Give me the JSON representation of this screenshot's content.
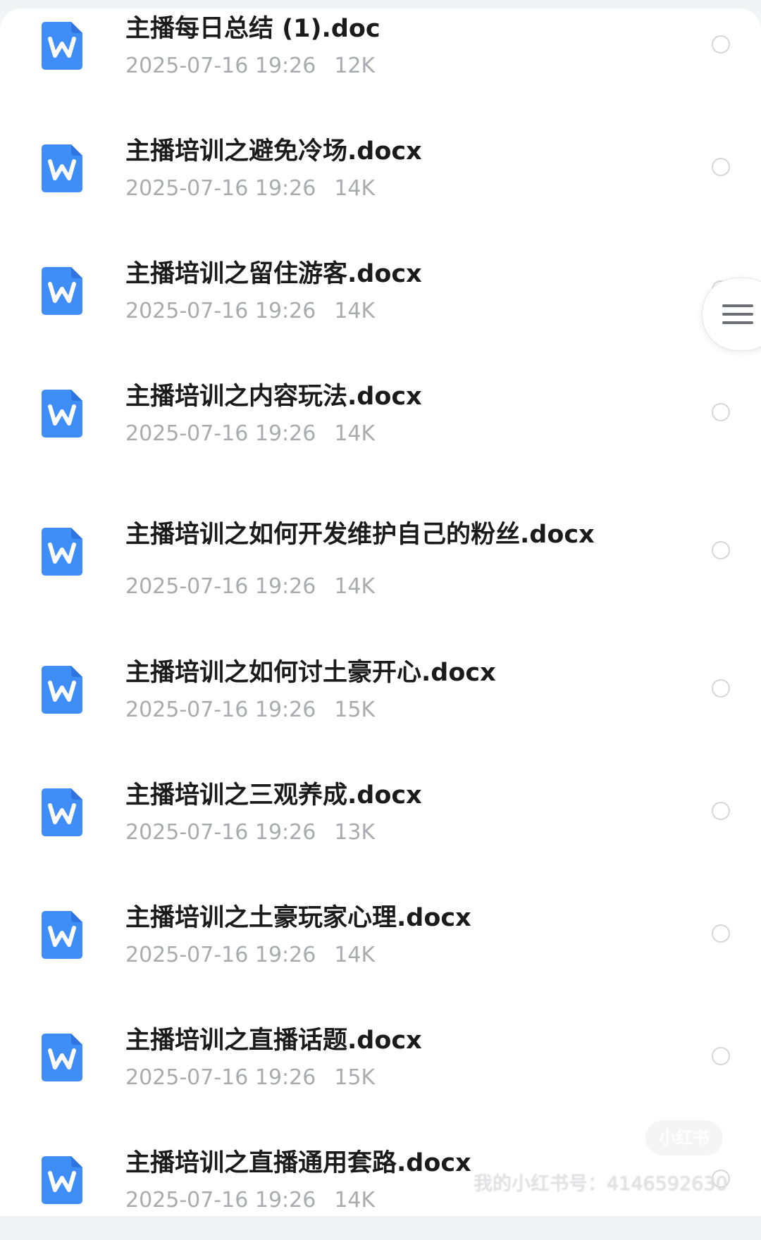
{
  "files": [
    {
      "name": "主播每日总结 (1).doc",
      "date": "2025-07-16 19:26",
      "size": "12K",
      "icon": "word-doc-icon"
    },
    {
      "name": "主播培训之避免冷场.docx",
      "date": "2025-07-16 19:26",
      "size": "14K",
      "icon": "word-doc-icon"
    },
    {
      "name": "主播培训之留住游客.docx",
      "date": "2025-07-16 19:26",
      "size": "14K",
      "icon": "word-doc-icon"
    },
    {
      "name": "主播培训之内容玩法.docx",
      "date": "2025-07-16 19:26",
      "size": "14K",
      "icon": "word-doc-icon"
    },
    {
      "name": "主播培训之如何开发维护自己的粉丝.docx",
      "date": "2025-07-16 19:26",
      "size": "14K",
      "icon": "word-doc-icon"
    },
    {
      "name": "主播培训之如何讨土豪开心.docx",
      "date": "2025-07-16 19:26",
      "size": "15K",
      "icon": "word-doc-icon"
    },
    {
      "name": "主播培训之三观养成.docx",
      "date": "2025-07-16 19:26",
      "size": "13K",
      "icon": "word-doc-icon"
    },
    {
      "name": "主播培训之土豪玩家心理.docx",
      "date": "2025-07-16 19:26",
      "size": "14K",
      "icon": "word-doc-icon"
    },
    {
      "name": "主播培训之直播话题.docx",
      "date": "2025-07-16 19:26",
      "size": "15K",
      "icon": "word-doc-icon"
    },
    {
      "name": "主播培训之直播通用套路.docx",
      "date": "2025-07-16 19:26",
      "size": "14K",
      "icon": "word-doc-icon"
    }
  ],
  "menu_button": {
    "icon": "menu-icon"
  },
  "watermark": {
    "text": "我的小红书号：4146592630",
    "badge": "小红书"
  },
  "colors": {
    "icon_blue": "#3f8ef7",
    "title": "#1b1b1b",
    "meta": "#a9abaf"
  }
}
